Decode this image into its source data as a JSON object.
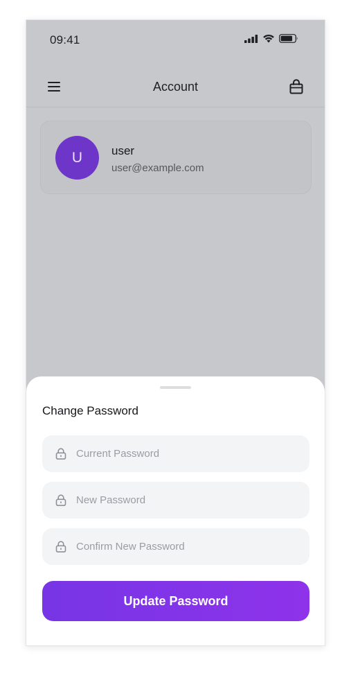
{
  "status_bar": {
    "time": "09:41",
    "icons": [
      "signal-icon",
      "wifi-icon",
      "battery-icon"
    ]
  },
  "header": {
    "menu_icon": "menu-icon",
    "title": "Account",
    "cart_icon": "shopping-bag-icon"
  },
  "profile": {
    "avatar_initial": "U",
    "avatar_color": "#6e35c9",
    "name": "user",
    "email": "user@example.com"
  },
  "change_password_sheet": {
    "title": "Change Password",
    "fields": [
      {
        "icon": "lock-icon",
        "value": "",
        "placeholder": "Current Password"
      },
      {
        "icon": "lock-icon",
        "value": "",
        "placeholder": "New Password"
      },
      {
        "icon": "lock-icon",
        "value": "",
        "placeholder": "Confirm New Password"
      }
    ],
    "submit_label": "Update Password"
  },
  "colors": {
    "accent": "#7735e6",
    "overlay_background": "#c7c8cc",
    "sheet_background": "#ffffff",
    "input_background": "#f3f4f6"
  }
}
